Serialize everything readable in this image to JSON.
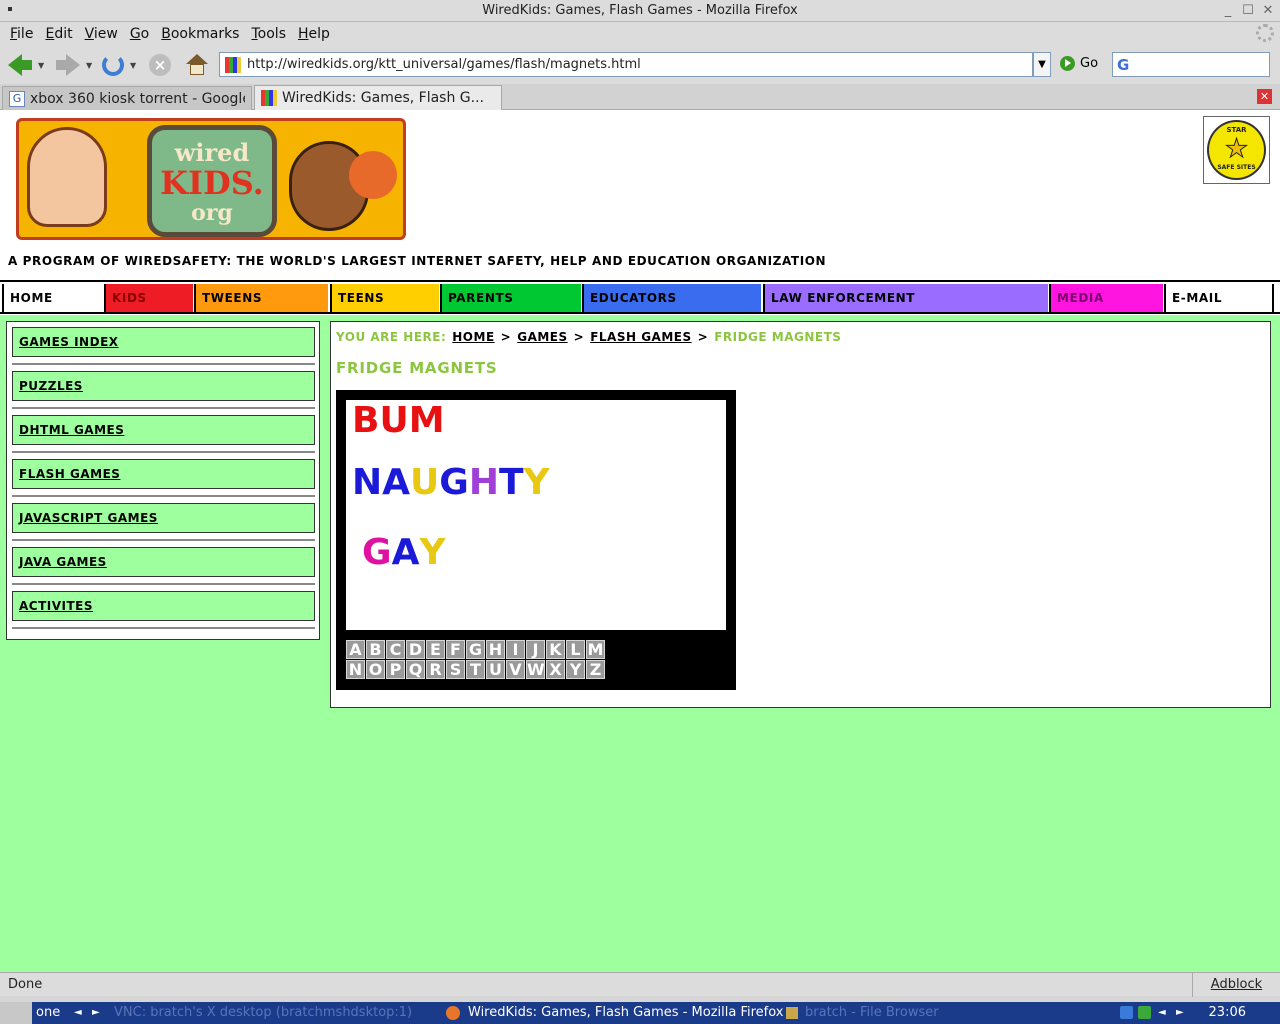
{
  "window": {
    "title": "WiredKids: Games, Flash Games - Mozilla Firefox"
  },
  "menu": [
    "File",
    "Edit",
    "View",
    "Go",
    "Bookmarks",
    "Tools",
    "Help"
  ],
  "toolbar": {
    "url": "http://wiredkids.org/ktt_universal/games/flash/magnets.html",
    "go_label": "Go"
  },
  "tabs": [
    {
      "label": "xbox 360 kiosk torrent - Google ...",
      "active": false
    },
    {
      "label": "WiredKids: Games, Flash G...",
      "active": true
    }
  ],
  "header": {
    "tagline": "A PROGRAM OF WIREDSAFETY: THE WORLD'S LARGEST INTERNET SAFETY, HELP AND EDUCATION ORGANIZATION",
    "logo": {
      "wired": "wired",
      "kids": "KIDS.",
      "org": "org"
    },
    "badge": {
      "top": "STAR",
      "bottom": "SAFE SITES"
    }
  },
  "nav": [
    {
      "label": "HOME",
      "color": "#ffffff",
      "text_color": "#000000"
    },
    {
      "label": "KIDS",
      "color": "#ee1c24",
      "text_color": "#8a0000"
    },
    {
      "label": "TWEENS",
      "color": "#ff9a0e",
      "text_color": "#000000"
    },
    {
      "label": "TEENS",
      "color": "#ffcf00",
      "text_color": "#000000"
    },
    {
      "label": "PARENTS",
      "color": "#00c832",
      "text_color": "#000000"
    },
    {
      "label": "EDUCATORS",
      "color": "#3a6cf0",
      "text_color": "#000000"
    },
    {
      "label": "LAW ENFORCEMENT",
      "color": "#9a6cff",
      "text_color": "#000000"
    },
    {
      "label": "MEDIA",
      "color": "#ff14e0",
      "text_color": "#7a0070"
    },
    {
      "label": "E-MAIL",
      "color": "#ffffff",
      "text_color": "#000000"
    }
  ],
  "sidebar": [
    {
      "label": "GAMES INDEX"
    },
    {
      "label": "PUZZLES"
    },
    {
      "label": "DHTML GAMES"
    },
    {
      "label": "FLASH GAMES"
    },
    {
      "label": "JAVASCRIPT GAMES"
    },
    {
      "label": "JAVA GAMES"
    },
    {
      "label": "ACTIVITES"
    }
  ],
  "breadcrumb": {
    "prefix": "YOU ARE HERE:",
    "links": [
      "HOME",
      "GAMES",
      "FLASH GAMES"
    ],
    "current": "FRIDGE MAGNETS",
    "sep": ">"
  },
  "page_title": "FRIDGE MAGNETS",
  "game": {
    "words": [
      {
        "letters": [
          {
            "ch": "B",
            "color": "#e81010"
          },
          {
            "ch": "U",
            "color": "#e81010"
          },
          {
            "ch": "M",
            "color": "#e81010"
          }
        ]
      },
      {
        "letters": [
          {
            "ch": "N",
            "color": "#1a1ad8"
          },
          {
            "ch": "A",
            "color": "#1a1ad8"
          },
          {
            "ch": "U",
            "color": "#e8c810"
          },
          {
            "ch": "G",
            "color": "#1a1ad8"
          },
          {
            "ch": "H",
            "color": "#a040d8"
          },
          {
            "ch": "T",
            "color": "#1a1ad8"
          },
          {
            "ch": "Y",
            "color": "#e8c810"
          }
        ]
      },
      {
        "letters": [
          {
            "ch": "G",
            "color": "#e010a0"
          },
          {
            "ch": "A",
            "color": "#1a1ad8"
          },
          {
            "ch": "Y",
            "color": "#e8c810"
          }
        ]
      }
    ],
    "keys_row1": [
      "A",
      "B",
      "C",
      "D",
      "E",
      "F",
      "G",
      "H",
      "I",
      "J",
      "K",
      "L",
      "M"
    ],
    "keys_row2": [
      "N",
      "O",
      "P",
      "Q",
      "R",
      "S",
      "T",
      "U",
      "V",
      "W",
      "X",
      "Y",
      "Z"
    ]
  },
  "status": {
    "text": "Done",
    "adblock": "Adblock"
  },
  "taskbar": {
    "workspace": "one",
    "items": [
      "VNC: bratch's X desktop (bratchmshdsktop:1)",
      "WiredKids: Games, Flash Games - Mozilla Firefox",
      "bratch - File Browser"
    ],
    "clock": "23:06"
  }
}
